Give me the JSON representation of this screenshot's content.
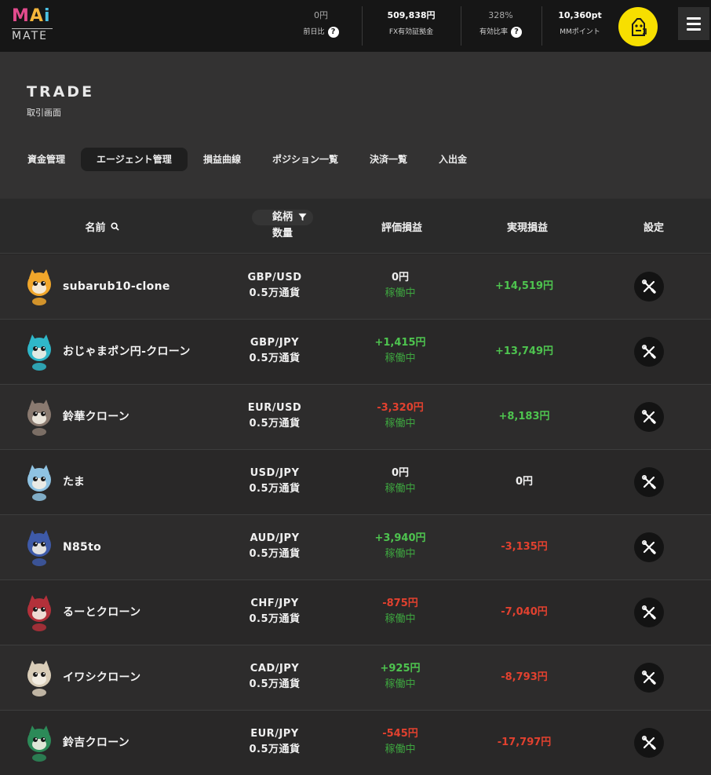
{
  "logo": {
    "line1": "MAi",
    "line2": "MATE"
  },
  "stats": [
    {
      "value": "0円",
      "label": "前日比",
      "help": "?"
    },
    {
      "value": "509,838円",
      "label": "FX有効証拠金"
    },
    {
      "value": "328%",
      "label": "有効比率",
      "help": "?"
    },
    {
      "value": "10,360pt",
      "label": "MMポイント"
    }
  ],
  "header": {
    "title": "TRADE",
    "subtitle": "取引画面"
  },
  "tabs": [
    {
      "label": "資金管理"
    },
    {
      "label": "エージェント管理",
      "active": true
    },
    {
      "label": "損益曲線"
    },
    {
      "label": "ポジション一覧"
    },
    {
      "label": "決済一覧"
    },
    {
      "label": "入出金"
    }
  ],
  "table": {
    "col_name": "名前",
    "col_pair": "銘柄",
    "col_qty": "数量",
    "col_eval": "評価損益",
    "col_real": "実現損益",
    "col_settings": "設定"
  },
  "rows": [
    {
      "name": "subarub10-clone",
      "pair": "GBP/USD",
      "qty": "0.5万通貨",
      "eval": "0円",
      "eval_sign": "neu",
      "status": "稼働中",
      "real": "+14,519円",
      "real_sign": "pos",
      "avatar": "mushroom",
      "color": "#f0a62b"
    },
    {
      "name": "おじゃまポン円-クローン",
      "pair": "GBP/JPY",
      "qty": "0.5万通貨",
      "eval": "+1,415円",
      "eval_sign": "pos",
      "status": "稼働中",
      "real": "+13,749円",
      "real_sign": "pos",
      "avatar": "cyan-cat",
      "color": "#2fb7c9"
    },
    {
      "name": "鈴華クローン",
      "pair": "EUR/USD",
      "qty": "0.5万通貨",
      "eval": "-3,320円",
      "eval_sign": "neg",
      "status": "稼働中",
      "real": "+8,183円",
      "real_sign": "pos",
      "avatar": "mouse",
      "color": "#8a7a70"
    },
    {
      "name": "たま",
      "pair": "USD/JPY",
      "qty": "0.5万通貨",
      "eval": "0円",
      "eval_sign": "neu",
      "status": "稼働中",
      "real": "0円",
      "real_sign": "neu",
      "avatar": "blue-blob",
      "color": "#8fc3e2"
    },
    {
      "name": "N85to",
      "pair": "AUD/JPY",
      "qty": "0.5万通貨",
      "eval": "+3,940円",
      "eval_sign": "pos",
      "status": "稼働中",
      "real": "-3,135円",
      "real_sign": "neg",
      "avatar": "wolf",
      "color": "#3e5aa8"
    },
    {
      "name": "るーとクローン",
      "pair": "CHF/JPY",
      "qty": "0.5万通貨",
      "eval": "-875円",
      "eval_sign": "neg",
      "status": "稼働中",
      "real": "-7,040円",
      "real_sign": "neg",
      "avatar": "red-dragon",
      "color": "#b3303a"
    },
    {
      "name": "イワシクローン",
      "pair": "CAD/JPY",
      "qty": "0.5万通貨",
      "eval": "+925円",
      "eval_sign": "pos",
      "status": "稼働中",
      "real": "-8,793円",
      "real_sign": "neg",
      "avatar": "monkey",
      "color": "#d9cdb8"
    },
    {
      "name": "鈴吉クローン",
      "pair": "EUR/JPY",
      "qty": "0.5万通貨",
      "eval": "-545円",
      "eval_sign": "neg",
      "status": "稼働中",
      "real": "-17,797円",
      "real_sign": "neg",
      "avatar": "lion",
      "color": "#2c8a58"
    }
  ],
  "icons": {
    "help": "help-icon",
    "search": "search-icon",
    "filter": "filter-icon",
    "settings": "tools-icon",
    "menu": "hamburger-icon",
    "user": "user-avatar-icon"
  }
}
